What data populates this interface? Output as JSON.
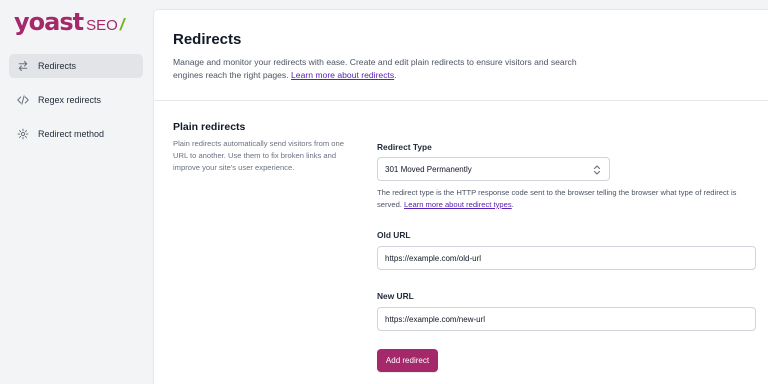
{
  "logo": {
    "brand": "yoast",
    "product": "SEO",
    "slash": "/"
  },
  "sidebar": {
    "items": [
      {
        "label": "Redirects",
        "icon": "arrows-right-left-icon",
        "active": true
      },
      {
        "label": "Regex redirects",
        "icon": "code-icon",
        "active": false
      },
      {
        "label": "Redirect method",
        "icon": "gear-icon",
        "active": false
      }
    ]
  },
  "header": {
    "title": "Redirects",
    "description": "Manage and monitor your redirects with ease. Create and edit plain redirects to ensure visitors and search engines reach the right pages. ",
    "link": "Learn more about redirects",
    "link_suffix": "."
  },
  "section": {
    "title": "Plain redirects",
    "description": "Plain redirects automatically send visitors from one URL to another. Use them to fix broken links and improve your site's user experience."
  },
  "form": {
    "redirect_type": {
      "label": "Redirect Type",
      "value": "301 Moved Permanently",
      "help": "The redirect type is the HTTP response code sent to the browser telling the browser what type of redirect is served. ",
      "help_link": "Learn more about redirect types",
      "help_suffix": "."
    },
    "old_url": {
      "label": "Old URL",
      "value": "https://example.com/old-url"
    },
    "new_url": {
      "label": "New URL",
      "value": "https://example.com/new-url"
    },
    "submit_label": "Add redirect"
  },
  "colors": {
    "brand": "#a4286a",
    "accent_green": "#77b227",
    "link": "#5b21b6"
  }
}
